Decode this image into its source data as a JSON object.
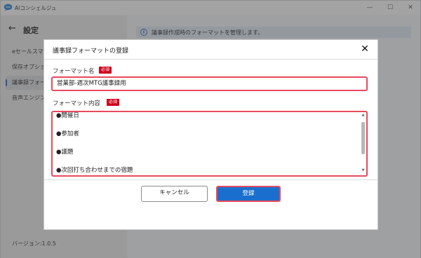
{
  "window": {
    "title": "AIコンシェルジュ",
    "controls": {
      "minimize": "—",
      "maximize": "☐",
      "close": "✕"
    }
  },
  "sidebar": {
    "back_icon": "←",
    "title": "設定",
    "items": [
      {
        "label": "eセールスマネージャー連携",
        "selected": false
      },
      {
        "label": "保存オプション",
        "selected": false
      },
      {
        "label": "議事録フォーマット",
        "selected": true
      },
      {
        "label": "音声エンジン",
        "selected": false
      }
    ],
    "version": "バージョン:1.0.5"
  },
  "main": {
    "info_icon": "i",
    "info_text": "議事録作成時のフォーマットを管理します。"
  },
  "dialog": {
    "title": "議事録フォーマットの登録",
    "close_icon": "✕",
    "name_label": "フォーマット名",
    "name_required": "必須",
    "name_value": "営業部-週次MTG議事録用",
    "content_label": "フォーマット内容",
    "content_required": "必須",
    "content_lines": [
      "●開催日",
      "●参加者",
      "●議題",
      "●次回打ち合わせまでの宿題"
    ],
    "scroll_up_icon": "▲",
    "scroll_down_icon": "▼",
    "cancel_label": "キャンセル",
    "register_label": "登録"
  },
  "colors": {
    "accent": "#1a6fce",
    "required_badge": "#d0021b",
    "highlight_border": "#e84a5f"
  }
}
